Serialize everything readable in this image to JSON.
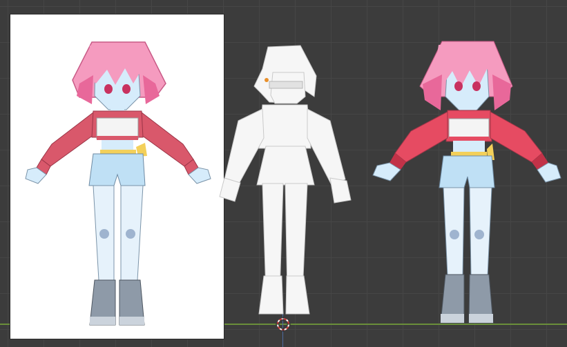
{
  "viewport": {
    "background": "#3c3c3c",
    "grid_color": "#464646",
    "x_axis_color": "#6a8f3a",
    "y_axis_color": "#4d6aa0"
  },
  "reference_image": {
    "description_icon": "character-turnaround-reference"
  },
  "figures": {
    "reference_color": "character-colored-reference",
    "white_mesh": "character-untextured-mesh",
    "textured_mesh": "character-textured-mesh"
  },
  "palette": {
    "hair": "#f59bbf",
    "hair_dark": "#e8689a",
    "skin": "#d6ecfb",
    "jacket": "#d9586b",
    "shirt": "#f4f4f4",
    "shorts": "#bfe0f5",
    "belt": "#f3d05a",
    "boots": "#8e9aa8",
    "white_mesh": "#f6f6f6"
  }
}
